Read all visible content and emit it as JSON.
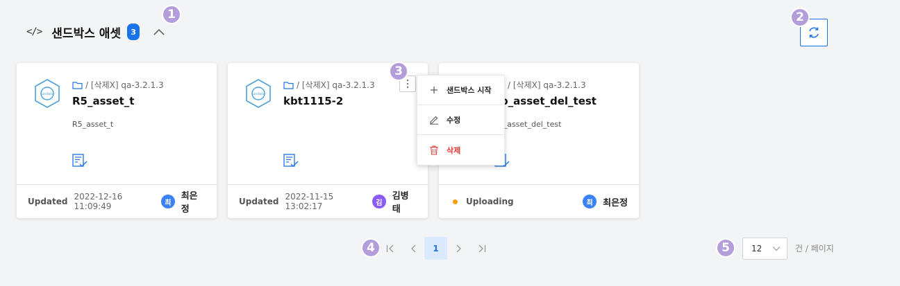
{
  "markers": [
    "1",
    "2",
    "3",
    "4",
    "5"
  ],
  "header": {
    "code_icon": "</>",
    "title": "샌드박스 애셋",
    "count": "3"
  },
  "cards": [
    {
      "path": "/ [삭제X] qa-3.2.1.3",
      "name": "R5_asset_t",
      "description": "R5_asset_t",
      "status_label": "Updated",
      "status_time": "2022-12-16 11:09:49",
      "owner_initial": "최",
      "owner_name": "최은정",
      "avatar_color": "#3b82f6"
    },
    {
      "path": "/ [삭제X] qa-3.2.1.3",
      "name": "kbt1115-2",
      "description": "",
      "status_label": "Updated",
      "status_time": "2022-11-15 13:02:17",
      "owner_initial": "김",
      "owner_name": "김병태",
      "avatar_color": "#8b5cf6"
    },
    {
      "path": "/ [삭제X] qa-3.2.1.3",
      "name": "sb_asset_del_test",
      "description": "sb_asset_del_test",
      "status_label": "Uploading",
      "status_time": "",
      "owner_initial": "최",
      "owner_name": "최은정",
      "avatar_color": "#3b82f6"
    }
  ],
  "context_menu": {
    "items": [
      {
        "label": "샌드박스 시작",
        "icon": "plus-icon"
      },
      {
        "label": "수정",
        "icon": "pencil-icon"
      },
      {
        "label": "삭제",
        "icon": "trash-icon"
      }
    ]
  },
  "pagination": {
    "current_page": "1"
  },
  "per_page": {
    "value": "12",
    "label": "건 / 페이지"
  },
  "colors": {
    "accent": "#1a73e8",
    "danger": "#e53935",
    "uploading": "#f59e0b",
    "marker": "#b39ddb"
  }
}
